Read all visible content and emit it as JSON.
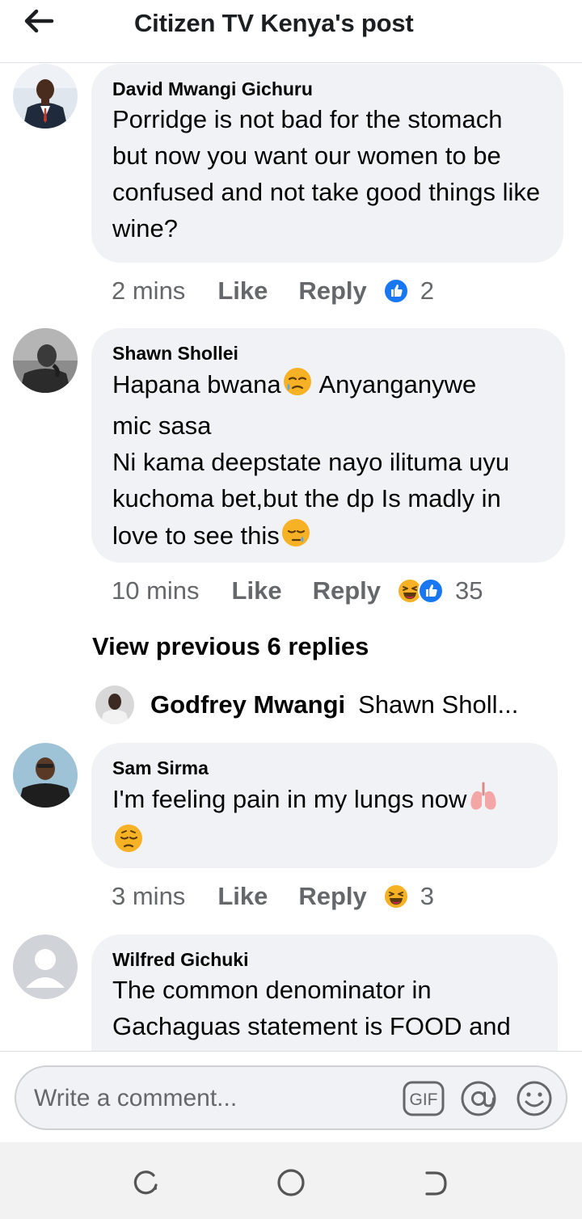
{
  "header": {
    "back_icon": "arrow-left-icon",
    "title": "Citizen TV Kenya's post"
  },
  "comments": [
    {
      "author": "David Mwangi Gichuru",
      "text": "Porridge is not bad for the stomach but now you want our women to be confused and not take good things like wine?",
      "time": "2 mins",
      "like_label": "Like",
      "reply_label": "Reply",
      "reactions": [
        "like"
      ],
      "reaction_count": "2"
    },
    {
      "author": "Shawn Shollei",
      "text_line1_a": "Hapana bwana",
      "text_line1_b": " Anyanganywe",
      "text_line2": "mic sasa",
      "text_line3": "Ni kama deepstate nayo ilituma uyu",
      "text_line4": "kuchoma bet,but the dp Is madly in",
      "text_line5": "love to see this",
      "emojis": [
        "holding-back-tears-emoji",
        "sleepy-face-emoji"
      ],
      "time": "10 mins",
      "like_label": "Like",
      "reply_label": "Reply",
      "reactions": [
        "haha",
        "like"
      ],
      "reaction_count": "35"
    },
    {
      "author": "Sam Sirma",
      "text": "I'm feeling pain in my lungs now",
      "emojis": [
        "lungs-emoji",
        "pensive-face-emoji"
      ],
      "time": "3 mins",
      "like_label": "Like",
      "reply_label": "Reply",
      "reactions": [
        "haha"
      ],
      "reaction_count": "3"
    },
    {
      "author": "Wilfred Gichuki",
      "text": "The common denominator in Gachaguas statement is FOOD and"
    }
  ],
  "replies_block": {
    "view_previous": "View previous 6 replies",
    "preview_name": "Godfrey Mwangi",
    "preview_snippet": "Shawn Sholl..."
  },
  "composer": {
    "placeholder": "Write a comment...",
    "gif_label": "GIF",
    "mention_icon": "at-sign-icon",
    "emoji_icon": "smiley-icon"
  },
  "android_nav": {
    "recents_icon": "recents-icon",
    "home_icon": "home-circle-icon",
    "back_icon": "back-arrow-icon"
  },
  "colors": {
    "bubble": "#f0f2f5",
    "meta": "#65676b",
    "like_blue": "#1877f2",
    "haha_yellow": "#f7b125"
  }
}
